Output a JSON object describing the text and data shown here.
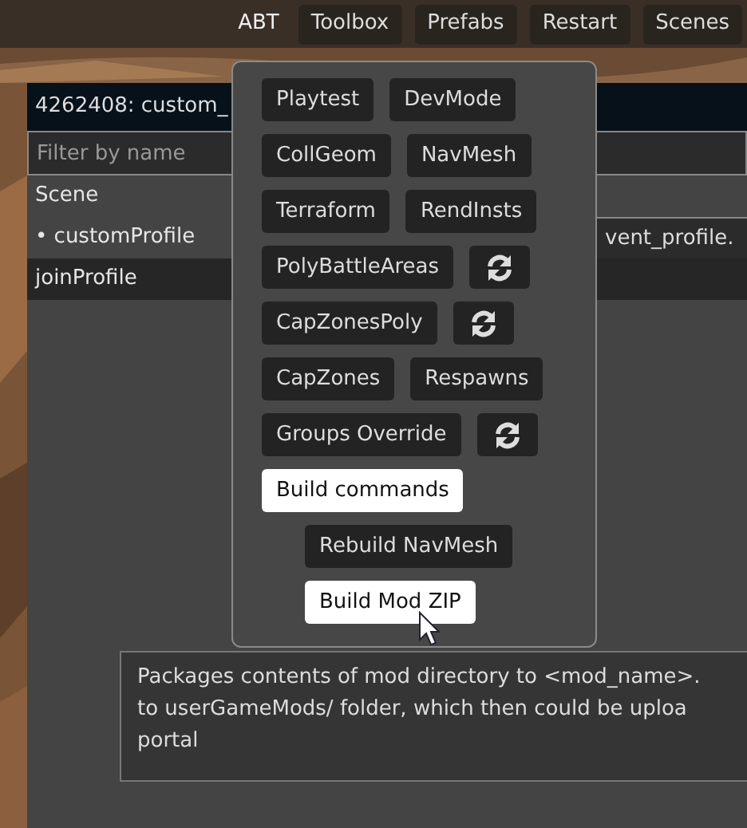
{
  "top_bar": {
    "label": "ABT",
    "buttons": [
      "Toolbox",
      "Prefabs",
      "Restart",
      "Scenes"
    ]
  },
  "panel": {
    "title": "4262408: custom_",
    "filter": {
      "placeholder": "Filter by name"
    },
    "rows": [
      {
        "label": "Scene",
        "selected": false
      },
      {
        "label": "• customProfile",
        "value": "vent_profile.",
        "selected": false
      },
      {
        "label": "joinProfile",
        "selected": true
      }
    ]
  },
  "menu": {
    "rows": [
      {
        "items": [
          {
            "kind": "button",
            "label": "Playtest",
            "highlighted": false
          },
          {
            "kind": "button",
            "label": "DevMode",
            "highlighted": false
          }
        ]
      },
      {
        "items": [
          {
            "kind": "button",
            "label": "CollGeom",
            "highlighted": false
          },
          {
            "kind": "button",
            "label": "NavMesh",
            "highlighted": false
          }
        ]
      },
      {
        "items": [
          {
            "kind": "button",
            "label": "Terraform",
            "highlighted": false
          },
          {
            "kind": "button",
            "label": "RendInsts",
            "highlighted": false
          }
        ]
      },
      {
        "items": [
          {
            "kind": "button",
            "label": "PolyBattleAreas",
            "highlighted": false
          },
          {
            "kind": "refresh"
          }
        ]
      },
      {
        "items": [
          {
            "kind": "button",
            "label": "CapZonesPoly",
            "highlighted": false
          },
          {
            "kind": "refresh"
          }
        ]
      },
      {
        "items": [
          {
            "kind": "button",
            "label": "CapZones",
            "highlighted": false
          },
          {
            "kind": "button",
            "label": "Respawns",
            "highlighted": false
          }
        ]
      },
      {
        "items": [
          {
            "kind": "button",
            "label": "Groups Override",
            "highlighted": false
          },
          {
            "kind": "refresh"
          }
        ]
      },
      {
        "items": [
          {
            "kind": "button",
            "label": "Build commands",
            "highlighted": true
          }
        ],
        "children": [
          {
            "items": [
              {
                "kind": "button",
                "label": "Rebuild NavMesh",
                "highlighted": false
              }
            ]
          },
          {
            "items": [
              {
                "kind": "button",
                "label": "Build Mod ZIP",
                "highlighted": true
              }
            ]
          }
        ]
      }
    ]
  },
  "tooltip": {
    "lines": [
      "Packages contents of mod directory to <mod_name>.",
      "to userGameMods/ folder, which then could be uploa",
      "portal"
    ]
  }
}
